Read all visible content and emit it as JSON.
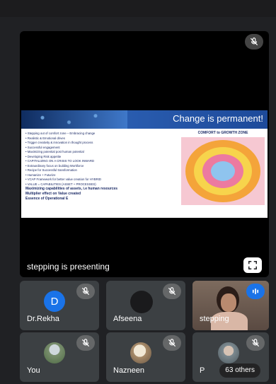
{
  "stage": {
    "presenting_label": "stepping is presenting",
    "slide": {
      "title": "Change is permanent!",
      "bullets": [
        "Stepping out of comfort zone – Embracing change",
        "Realistic & Emotional drives",
        "Trigger creativity & innovation in thought process",
        "Successful engagement",
        "Maximizing potential post human potential",
        "Developing Risk appetite",
        "CAPITALIZING ON A CRISIS TO LOOK INWARD",
        "Extraordinary focus on building Workforce",
        "Recipe for Successful transformation",
        "Humanize + Futurize",
        "VCAP Framework for better value creation for HYBRID",
        "VALUE = CAPABILITIES (ASSET + PROCESSES)"
      ],
      "strong_lines": [
        "Maximizing capabilities of assets, i.e human resources",
        "Multiplier effect on Value created",
        "Essence of Operational E"
      ],
      "zone_title": "COMFORT to GROWTH ZONE"
    }
  },
  "participants": [
    {
      "name": "Dr.Rekha",
      "initial": "D",
      "avatar_color": "#1a73e8",
      "muted": true
    },
    {
      "name": "Afseena",
      "muted": true
    },
    {
      "name": "stepping",
      "muted": false,
      "speaking": true
    },
    {
      "name": "You",
      "muted": true
    },
    {
      "name": "Nazneen",
      "muted": true
    },
    {
      "name": "P",
      "muted": true,
      "overflow_label": "63 others"
    }
  ],
  "icons": {
    "mic_off": "mic-off-icon",
    "speaking": "audio-level-icon",
    "fullscreen": "fullscreen-icon"
  }
}
